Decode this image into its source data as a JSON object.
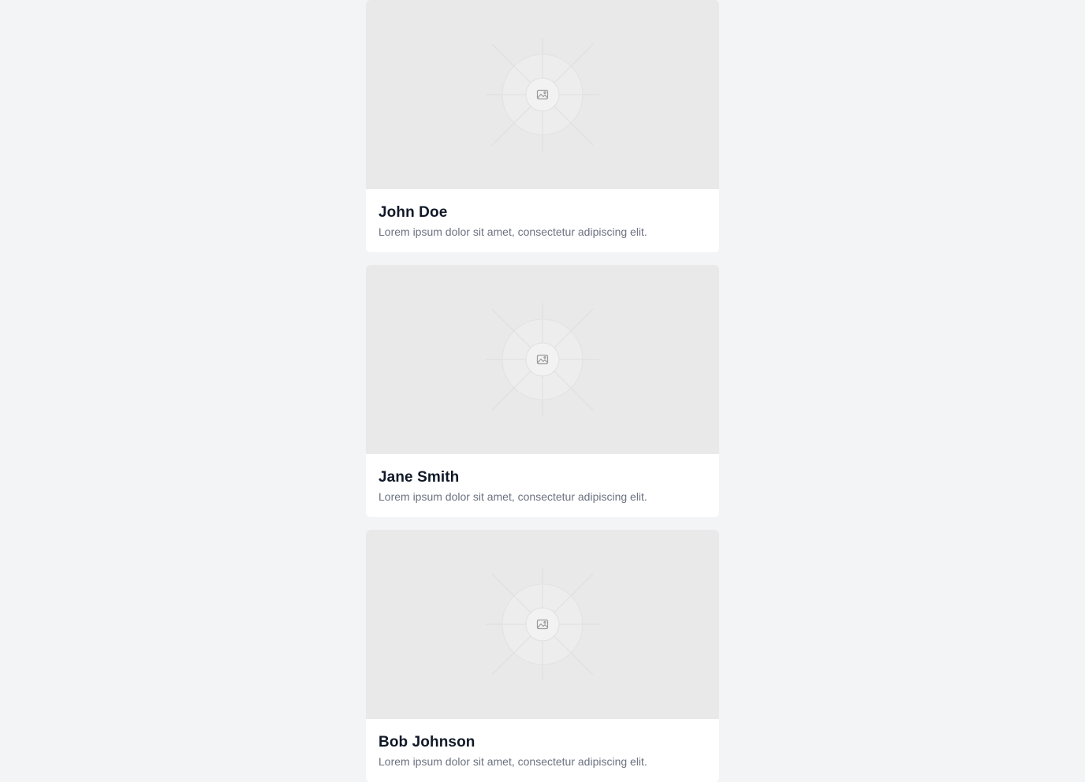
{
  "cards": [
    {
      "name": "John Doe",
      "description": "Lorem ipsum dolor sit amet, consectetur adipiscing elit.",
      "image_icon": "image-placeholder-icon"
    },
    {
      "name": "Jane Smith",
      "description": "Lorem ipsum dolor sit amet, consectetur adipiscing elit.",
      "image_icon": "image-placeholder-icon"
    },
    {
      "name": "Bob Johnson",
      "description": "Lorem ipsum dolor sit amet, consectetur adipiscing elit.",
      "image_icon": "image-placeholder-icon"
    }
  ],
  "colors": {
    "page_background": "#f3f4f6",
    "card_background": "#ffffff",
    "image_placeholder_background": "#e9e9e9",
    "name_text": "#111827",
    "description_text": "#6b7280"
  }
}
